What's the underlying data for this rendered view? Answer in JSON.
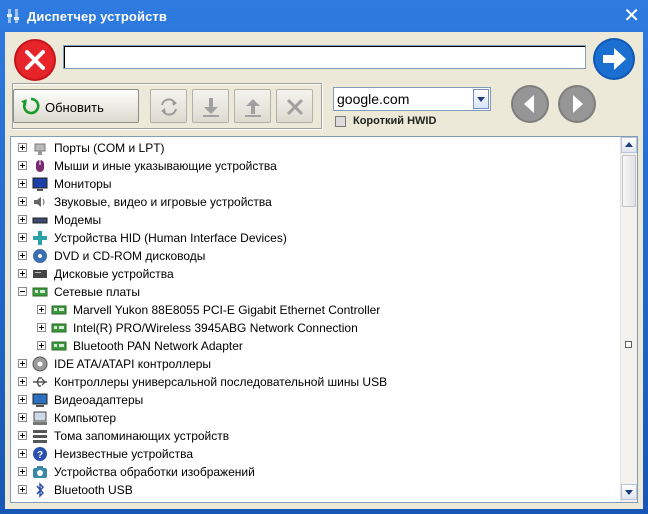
{
  "window": {
    "title": "Диспетчер устройств",
    "close_glyph": "✕"
  },
  "toolbar": {
    "address_value": "",
    "refresh_label": "Обновить",
    "search_engine": "google.com",
    "short_hwid_label": "Короткий HWID",
    "short_hwid_checked": false
  },
  "tree": [
    {
      "label": "Порты (COM и LPT)",
      "level": 0,
      "icon": "port-icon",
      "expanded": false
    },
    {
      "label": "Мыши и иные указывающие устройства",
      "level": 0,
      "icon": "mouse-icon",
      "expanded": false
    },
    {
      "label": "Мониторы",
      "level": 0,
      "icon": "monitor-icon",
      "expanded": false
    },
    {
      "label": "Звуковые, видео и игровые устройства",
      "level": 0,
      "icon": "speaker-icon",
      "expanded": false
    },
    {
      "label": "Модемы",
      "level": 0,
      "icon": "modem-icon",
      "expanded": false
    },
    {
      "label": "Устройства HID (Human Interface Devices)",
      "level": 0,
      "icon": "hid-icon",
      "expanded": false
    },
    {
      "label": "DVD и CD-ROM дисководы",
      "level": 0,
      "icon": "disc-icon",
      "expanded": false
    },
    {
      "label": "Дисковые устройства",
      "level": 0,
      "icon": "disk-icon",
      "expanded": false
    },
    {
      "label": "Сетевые платы",
      "level": 0,
      "icon": "network-card-icon",
      "expanded": true
    },
    {
      "label": "Marvell Yukon 88E8055 PCI-E Gigabit Ethernet Controller",
      "level": 1,
      "icon": "network-card-icon",
      "expanded": false
    },
    {
      "label": "Intel(R) PRO/Wireless 3945ABG Network Connection",
      "level": 1,
      "icon": "network-card-icon",
      "expanded": false
    },
    {
      "label": "Bluetooth PAN Network Adapter",
      "level": 1,
      "icon": "network-card-icon",
      "expanded": false
    },
    {
      "label": "IDE ATA/ATAPI контроллеры",
      "level": 0,
      "icon": "ide-icon",
      "expanded": false
    },
    {
      "label": "Контроллеры универсальной последовательной шины USB",
      "level": 0,
      "icon": "usb-icon",
      "expanded": false
    },
    {
      "label": "Видеоадаптеры",
      "level": 0,
      "icon": "display-adapter-icon",
      "expanded": false
    },
    {
      "label": "Компьютер",
      "level": 0,
      "icon": "computer-icon",
      "expanded": false
    },
    {
      "label": "Тома запоминающих устройств",
      "level": 0,
      "icon": "storage-volume-icon",
      "expanded": false
    },
    {
      "label": "Неизвестные устройства",
      "level": 0,
      "icon": "unknown-device-icon",
      "expanded": false
    },
    {
      "label": "Устройства обработки изображений",
      "level": 0,
      "icon": "camera-icon",
      "expanded": false
    },
    {
      "label": "Bluetooth USB",
      "level": 0,
      "icon": "bluetooth-icon",
      "expanded": false
    }
  ],
  "colors": {
    "title_bar": "#1f5fb4",
    "stop_red": "#e8242b",
    "go_blue": "#1b6fd0",
    "nav_gray": "#8c8c8c"
  }
}
